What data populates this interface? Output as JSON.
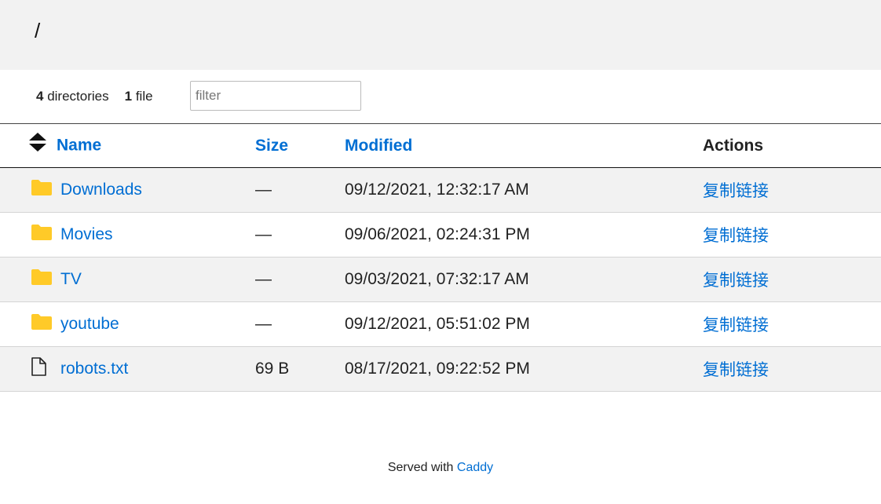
{
  "header": {
    "path": "/"
  },
  "meta": {
    "dir_count": "4",
    "dir_label": "directories",
    "file_count": "1",
    "file_label": "file",
    "filter_placeholder": "filter"
  },
  "table": {
    "columns": {
      "name": "Name",
      "size": "Size",
      "modified": "Modified",
      "actions": "Actions"
    },
    "rows": [
      {
        "type": "folder",
        "name": "Downloads",
        "size": "—",
        "modified": "09/12/2021, 12:32:17 AM",
        "action": "复制链接"
      },
      {
        "type": "folder",
        "name": "Movies",
        "size": "—",
        "modified": "09/06/2021, 02:24:31 PM",
        "action": "复制链接"
      },
      {
        "type": "folder",
        "name": "TV",
        "size": "—",
        "modified": "09/03/2021, 07:32:17 AM",
        "action": "复制链接"
      },
      {
        "type": "folder",
        "name": "youtube",
        "size": "—",
        "modified": "09/12/2021, 05:51:02 PM",
        "action": "复制链接"
      },
      {
        "type": "file",
        "name": "robots.txt",
        "size": "69 B",
        "modified": "08/17/2021, 09:22:52 PM",
        "action": "复制链接"
      }
    ]
  },
  "footer": {
    "prefix": "Served with",
    "link": "Caddy"
  },
  "colors": {
    "link": "#006ed3",
    "folder": "#ffca28",
    "header_bg": "#f2f2f2",
    "row_alt_bg": "#f2f2f2"
  },
  "icons": {
    "sort": "sort-icon",
    "folder": "folder-icon",
    "file": "file-icon"
  }
}
